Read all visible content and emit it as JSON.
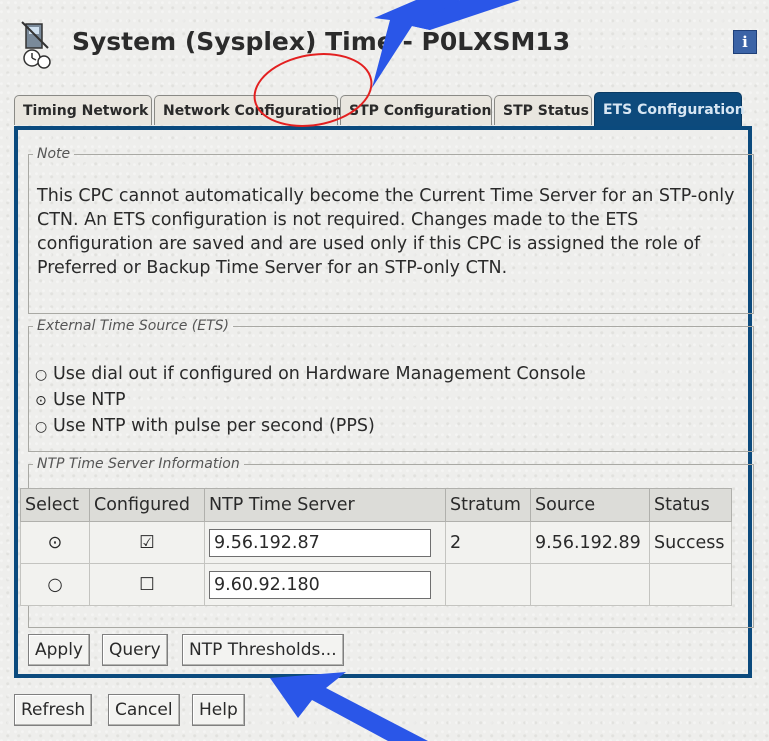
{
  "window": {
    "title": "System (Sysplex) Time - P0LXSM13",
    "info_icon": "i"
  },
  "tabs": [
    {
      "label": "Timing Network",
      "active": false
    },
    {
      "label": "Network Configuration",
      "active": false
    },
    {
      "label": "STP Configuration",
      "active": false
    },
    {
      "label": "STP Status",
      "active": false
    },
    {
      "label": "ETS Configuration",
      "active": true
    }
  ],
  "note": {
    "legend": "Note",
    "text": "This CPC cannot automatically become the Current Time Server for an STP-only CTN. An ETS configuration is not required. Changes made to the ETS configuration are saved and are used only if this CPC is assigned the role of Preferred or Backup Time Server for an STP-only CTN."
  },
  "ets": {
    "legend": "External Time Source (ETS)",
    "options": [
      {
        "label": "Use dial out if configured on Hardware Management Console",
        "selected": false
      },
      {
        "label": "Use NTP",
        "selected": true
      },
      {
        "label": "Use NTP with pulse per second (PPS)",
        "selected": false
      }
    ]
  },
  "ntp": {
    "legend": "NTP Time Server Information",
    "columns": [
      "Select",
      "Configured",
      "NTP Time Server",
      "Stratum",
      "Source",
      "Status"
    ],
    "rows": [
      {
        "select": "⊙",
        "configured": "☑",
        "server": "9.56.192.87",
        "stratum": "2",
        "source": "9.56.192.89",
        "status": "Success"
      },
      {
        "select": "○",
        "configured": "☐",
        "server": "9.60.92.180",
        "stratum": "",
        "source": "",
        "status": ""
      }
    ],
    "buttons": {
      "apply": "Apply",
      "query": "Query",
      "thresholds": "NTP Thresholds..."
    }
  },
  "footer_buttons": {
    "refresh": "Refresh",
    "cancel": "Cancel",
    "help": "Help"
  },
  "colors": {
    "accent": "#0b4a7d",
    "annotation_arrow": "#2a56e8",
    "annotation_circle": "#e32020"
  }
}
